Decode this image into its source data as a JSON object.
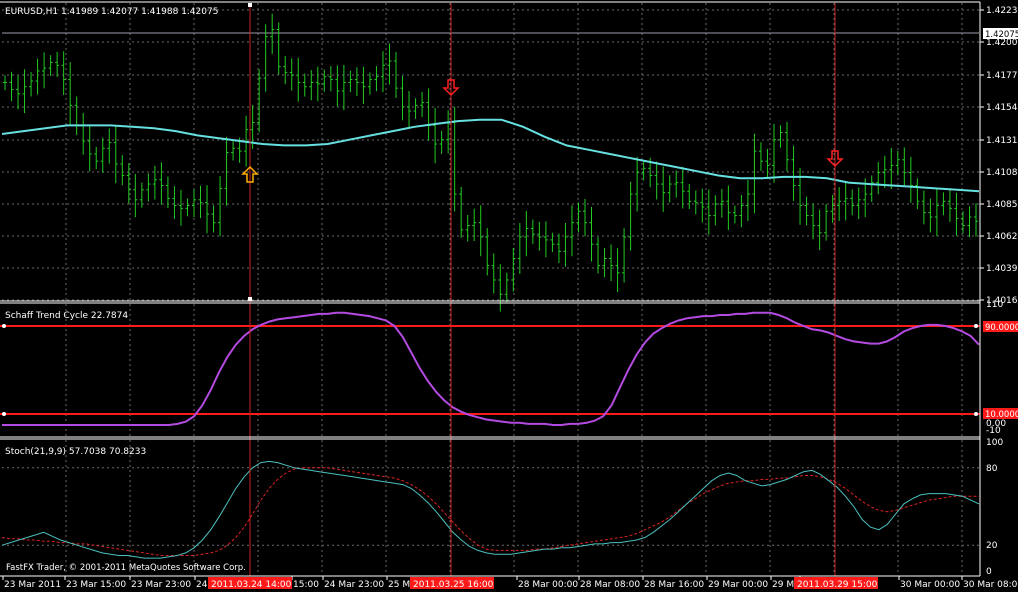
{
  "colors": {
    "background": "#000000",
    "grid": "#6a6a6a",
    "candle": "#22cc22",
    "ma": "#66e0e0",
    "stc": "#b44be0",
    "level": "#ff1a1a",
    "stoch_main": "#4ac0c0",
    "stoch_signal": "#dd2222",
    "cursor": "#cc2222",
    "arrow_up": "#ffaa00",
    "arrow_down": "#ff2020",
    "text": "#ffffff"
  },
  "price_panel": {
    "header": "EURUSD,H1  1.41989 1.42077 1.41988 1.42075",
    "scale": [
      "1.42235",
      "1.42005",
      "1.41775",
      "1.41545",
      "1.41315",
      "1.41080",
      "1.40850",
      "1.40620",
      "1.40390",
      "1.40160"
    ],
    "current_price": "1.42075"
  },
  "stc_panel": {
    "header": "Schaff Trend Cycle 22.7874",
    "scale": [
      "110",
      "-10",
      "0.00"
    ],
    "levels": [
      "90.0000",
      "10.0000"
    ]
  },
  "stoch_panel": {
    "header": "Stoch(21,9,9) 57.7038 70.8233",
    "scale": [
      "100",
      "80",
      "20",
      "0"
    ]
  },
  "x_axis": {
    "labels": [
      "23 Mar 2011",
      "23 Mar 15:00",
      "23 Mar 23:00",
      "24 M",
      "15:00",
      "24 Mar 23:00",
      "25 Ma",
      "28 Mar 00:00",
      "28 Mar 08:00",
      "28 Mar 16:00",
      "29 Mar 00:00",
      "29 Mar 08:00",
      "29 M",
      "30 Mar 00:00",
      "30 Mar 08:00"
    ],
    "cursor_dates": [
      "2011.03.24 14:00",
      "2011.03.25 16:00",
      "2011.03.29 15:00"
    ]
  },
  "copyright": "FastFX Trader, © 2001-2011 MetaQuotes Software Corp.",
  "chart_data": [
    {
      "type": "line",
      "title": "EURUSD,H1",
      "ohlc": [
        1.41989,
        1.42077,
        1.41988,
        1.42075
      ],
      "ylim": [
        1.4016,
        1.42235
      ],
      "grid": true,
      "series": [
        {
          "name": "",
          "values": [
            1.4168,
            1.4163,
            1.416,
            1.4165,
            1.4169,
            1.4176,
            1.4178,
            1.4182,
            1.418,
            1.417,
            1.4152,
            1.4138,
            1.4127,
            1.4118,
            1.4113,
            1.4122,
            1.4126,
            1.4111,
            1.4103,
            1.4093,
            1.4086,
            1.4093,
            1.4097,
            1.41,
            1.4096,
            1.4087,
            1.4082,
            1.408,
            1.4082,
            1.4086,
            1.4084,
            1.4076,
            1.407,
            1.4094,
            1.4119,
            1.4122,
            1.412,
            1.4135,
            1.414,
            1.4171,
            1.42,
            1.4205,
            1.4179,
            1.4175,
            1.4173,
            1.4168,
            1.4165,
            1.4168,
            1.4167,
            1.4172,
            1.417,
            1.4162,
            1.4168,
            1.417,
            1.4168,
            1.4165,
            1.417,
            1.4172,
            1.418,
            1.4183,
            1.4164,
            1.4151,
            1.4148,
            1.4152,
            1.4154,
            1.4138,
            1.4125,
            1.4128,
            1.414,
            1.409,
            1.4065,
            1.4068,
            1.407,
            1.406,
            1.404,
            1.403,
            1.402,
            1.403,
            1.4045,
            1.406,
            1.4066,
            1.4062,
            1.406,
            1.4058,
            1.4055,
            1.405,
            1.406,
            1.407,
            1.4078,
            1.407,
            1.4055,
            1.404,
            1.4045,
            1.404,
            1.4035,
            1.406,
            1.409,
            1.4105,
            1.4108,
            1.4103,
            1.4097,
            1.4091,
            1.4097,
            1.4098,
            1.4092,
            1.4085,
            1.4084,
            1.4081,
            1.4075,
            1.4083,
            1.4085,
            1.4077,
            1.4075,
            1.4082,
            1.409,
            1.412,
            1.4113,
            1.411,
            1.4128,
            1.4133,
            1.4114,
            1.4096,
            1.4082,
            1.4075,
            1.4068,
            1.4063,
            1.4078,
            1.4082,
            1.4085,
            1.4087,
            1.4082,
            1.4086,
            1.409,
            1.4098,
            1.4105,
            1.4107,
            1.411,
            1.4114,
            1.4105,
            1.4096,
            1.4085,
            1.4077,
            1.4074,
            1.4082,
            1.4085,
            1.408,
            1.4073,
            1.4068,
            1.4074,
            1.4071
          ]
        },
        {
          "name": "",
          "values": [
            1.4132,
            1.4134,
            1.4136,
            1.4138,
            1.4138,
            1.4138,
            1.4137,
            1.4136,
            1.4134,
            1.4131,
            1.4129,
            1.4127,
            1.4125,
            1.4124,
            1.4124,
            1.4125,
            1.4128,
            1.4131,
            1.4134,
            1.4137,
            1.4139,
            1.4141,
            1.4142,
            1.4142,
            1.4137,
            1.413,
            1.4124,
            1.4121,
            1.4118,
            1.4115,
            1.4112,
            1.4109,
            1.4106,
            1.4103,
            1.4101,
            1.4101,
            1.4102,
            1.4102,
            1.4101,
            1.4098,
            1.4097,
            1.4096,
            1.4095,
            1.4094,
            1.4093,
            1.4092
          ]
        }
      ]
    },
    {
      "type": "line",
      "title": "Schaff Trend Cycle 22.7874",
      "ylim": [
        -10,
        110
      ],
      "levels": [
        90,
        10
      ],
      "series": [
        {
          "name": "",
          "values": [
            0,
            0,
            0,
            0,
            0,
            0,
            0,
            0,
            0,
            0,
            0,
            0,
            0,
            0,
            0,
            0,
            0,
            0,
            0,
            0,
            0,
            1,
            3,
            8,
            18,
            32,
            48,
            62,
            73,
            81,
            87,
            91,
            94,
            96,
            97,
            98,
            99,
            100,
            101,
            101,
            102,
            102,
            101,
            100,
            99,
            97,
            95,
            90,
            80,
            66,
            52,
            40,
            30,
            22,
            16,
            12,
            9,
            7,
            5,
            4,
            3,
            2,
            2,
            1,
            1,
            1,
            0,
            0,
            1,
            1,
            2,
            4,
            8,
            18,
            34,
            50,
            64,
            75,
            83,
            88,
            92,
            95,
            97,
            98,
            99,
            99,
            100,
            100,
            101,
            101,
            102,
            102,
            102,
            100,
            97,
            93,
            90,
            87,
            86,
            84,
            81,
            78,
            76,
            75,
            74,
            74,
            76,
            80,
            85,
            88,
            90,
            91,
            91,
            90,
            88,
            85,
            81,
            73
          ]
        }
      ]
    },
    {
      "type": "line",
      "title": "Stoch(21,9,9) 57.7038 70.8233",
      "ylim": [
        0,
        100
      ],
      "series": [
        {
          "name": "",
          "values": [
            20,
            22,
            24,
            26,
            28,
            30,
            27,
            24,
            22,
            20,
            18,
            16,
            14,
            13,
            12,
            12,
            11,
            10,
            10,
            10,
            11,
            12,
            14,
            18,
            24,
            32,
            42,
            53,
            64,
            73,
            80,
            84,
            85,
            84,
            82,
            80,
            79,
            78,
            77,
            76,
            75,
            74,
            73,
            72,
            71,
            70,
            69,
            68,
            67,
            64,
            59,
            53,
            46,
            38,
            30,
            24,
            19,
            16,
            14,
            13,
            13,
            13,
            14,
            15,
            16,
            17,
            17,
            18,
            18,
            19,
            20,
            21,
            21,
            22,
            22,
            23,
            24,
            26,
            30,
            35,
            40,
            46,
            52,
            58,
            64,
            70,
            74,
            76,
            74,
            70,
            68,
            66,
            67,
            69,
            71,
            74,
            77,
            78,
            75,
            70,
            65,
            58,
            50,
            40,
            34,
            32,
            36,
            44,
            52,
            56,
            59,
            60,
            60,
            60,
            59,
            58,
            55,
            52
          ]
        },
        {
          "name": "",
          "values": [
            26,
            25,
            25,
            24,
            24,
            23,
            23,
            22,
            22,
            21,
            21,
            20,
            19,
            18,
            17,
            16,
            15,
            14,
            13,
            12,
            12,
            12,
            12,
            12,
            13,
            14,
            16,
            20,
            26,
            34,
            44,
            55,
            64,
            71,
            76,
            79,
            80,
            80,
            80,
            80,
            79,
            78,
            77,
            76,
            75,
            74,
            73,
            72,
            70,
            67,
            63,
            58,
            52,
            45,
            38,
            31,
            25,
            20,
            17,
            16,
            16,
            16,
            16,
            16,
            17,
            17,
            18,
            19,
            20,
            21,
            22,
            23,
            24,
            25,
            26,
            27,
            29,
            32,
            35,
            38,
            42,
            47,
            52,
            56,
            60,
            63,
            66,
            68,
            69,
            70,
            70,
            71,
            71,
            72,
            72,
            73,
            74,
            74,
            73,
            71,
            68,
            64,
            59,
            54,
            50,
            47,
            46,
            47,
            49,
            51,
            53,
            55,
            56,
            57,
            58,
            58,
            58,
            58
          ]
        }
      ]
    }
  ]
}
